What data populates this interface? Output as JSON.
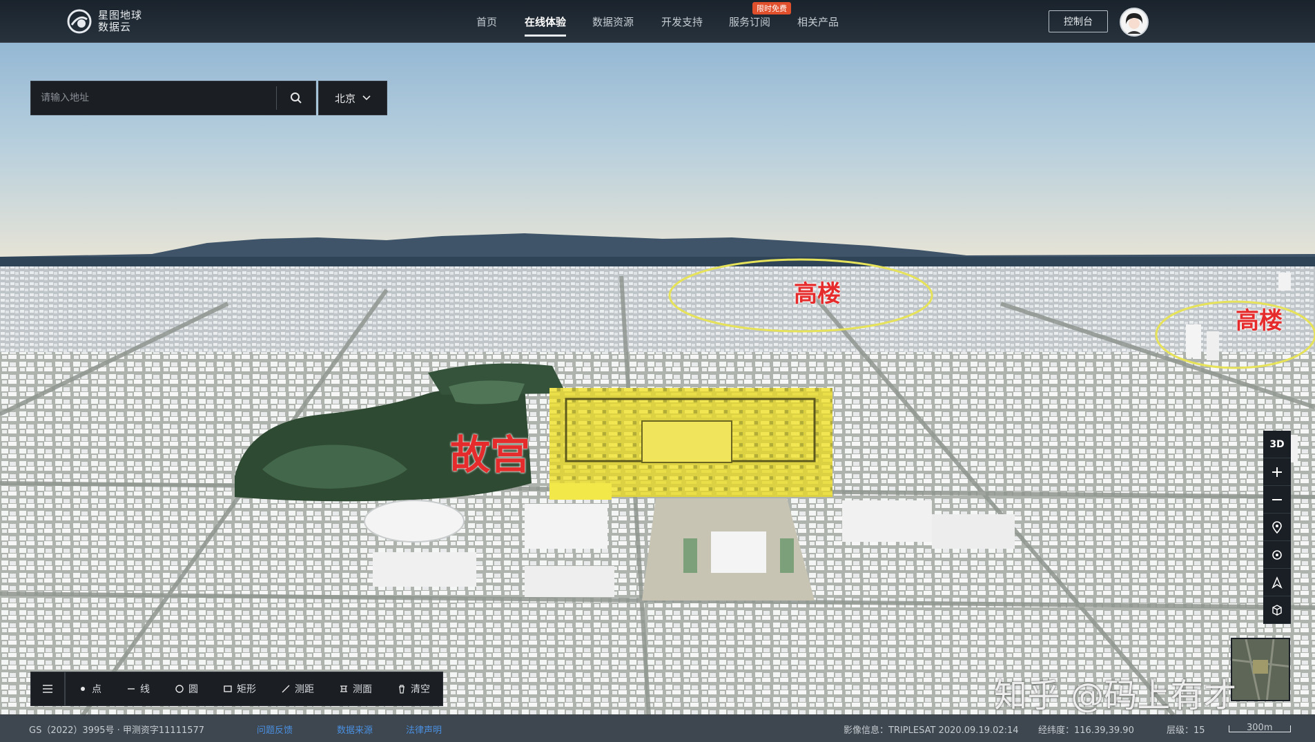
{
  "brand": {
    "line1": "星图地球",
    "line2": "数据云"
  },
  "nav": {
    "items": [
      {
        "label": "首页",
        "active": false
      },
      {
        "label": "在线体验",
        "active": true
      },
      {
        "label": "数据资源",
        "active": false
      },
      {
        "label": "开发支持",
        "active": false
      },
      {
        "label": "服务订阅",
        "active": false
      },
      {
        "label": "相关产品",
        "active": false
      }
    ],
    "promo_badge": "限时免费",
    "console": "控制台"
  },
  "search": {
    "placeholder": "请输入地址",
    "value": "",
    "city": "北京"
  },
  "map_labels": {
    "gugong": "故宫",
    "gaolou_1": "高楼",
    "gaolou_2": "高楼"
  },
  "controls": {
    "mode_3d": "3D"
  },
  "draw_tools": {
    "point": "点",
    "line": "线",
    "circle": "圆",
    "rect": "矩形",
    "measure_distance": "测距",
    "measure_area": "测面",
    "clear": "清空"
  },
  "status": {
    "license": "GS（2022）3995号 · 甲测资字11111577",
    "link_feedback": "问题反馈",
    "link_source": "数据来源",
    "link_legal": "法律声明",
    "imagery": "影像信息：TRIPLESAT 2020.09.19.02:14",
    "coords": "经纬度：116.39,39.90",
    "level": "层级：15",
    "scale": "300m"
  },
  "watermark": "知乎 @码上有才",
  "colors": {
    "label_red": "#e52b2b",
    "highlight_yellow": "#f3e84a",
    "ellipse": "#e6e25a",
    "link_blue": "#4a8fe0"
  }
}
